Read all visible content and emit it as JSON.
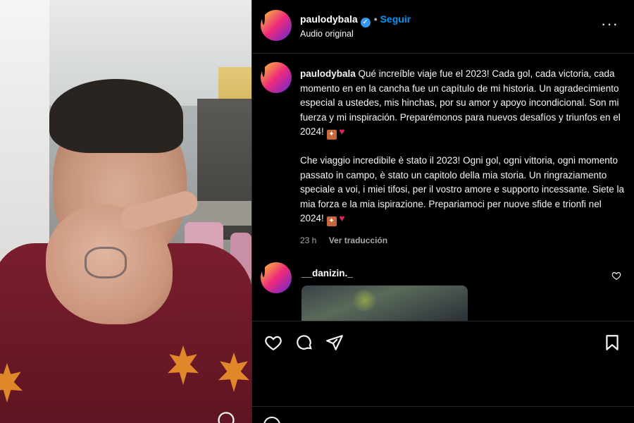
{
  "header": {
    "username": "paulodybala",
    "verified_glyph": "✓",
    "separator": "•",
    "follow_label": "Seguir",
    "audio_label": "Audio original",
    "more_label": "···"
  },
  "caption": {
    "username": "paulodybala",
    "text_es": "Qué increíble viaje fue el 2023! Cada gol, cada victoria, cada momento en en la cancha fue un capítulo de mi historia. Un agradecimiento especial a ustedes, mis hinchas, por su amor y apoyo incondicional. Son mi fuerza y mi inspiración. Preparémonos para nuevos desafíos y triunfos en el 2024!",
    "text_it": "Che viaggio incredibile è stato il 2023! Ogni gol, ogni vittoria, ogni momento passato in campo, è stato un capitolo della mia storia. Un ringraziamento speciale a voi, i miei tifosi, per il vostro amore e supporto incessante. Siete la mia forza e la mia ispirazione. Prepariamoci per nuove sfide e trionfi nel 2024!",
    "star_glyph": "✦",
    "heart_glyph": "♥",
    "time": "23 h",
    "translate_label": "Ver traducción"
  },
  "comment": {
    "username": "__danizin._",
    "like_icon": "heart-outline-icon"
  },
  "actions": {
    "like_icon": "heart-outline-icon",
    "comment_icon": "comment-bubble-icon",
    "share_icon": "paper-plane-icon",
    "save_icon": "bookmark-icon"
  },
  "colors": {
    "accent_blue": "#0095f6",
    "verified_blue": "#3897f0",
    "heart_red": "#e0245e",
    "background": "#000000"
  }
}
